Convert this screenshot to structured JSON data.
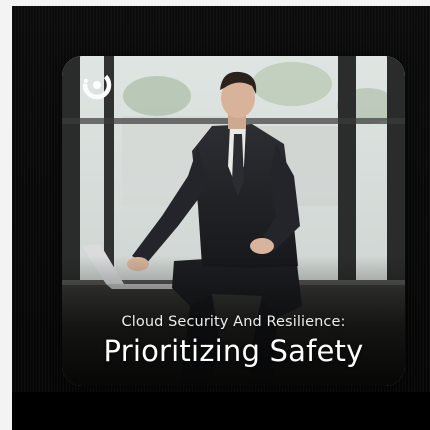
{
  "card": {
    "subtitle": "Cloud Security And Resilience:",
    "title": "Prioritizing Safety",
    "logo_icon": "brand-logo-icon"
  },
  "colors": {
    "background": "#0b0b0b",
    "text": "#ffffff"
  }
}
